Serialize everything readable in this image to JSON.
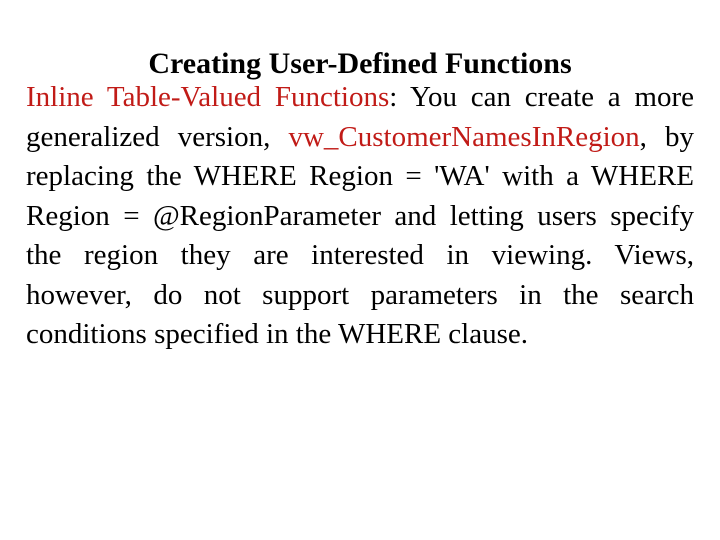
{
  "slide": {
    "title": "Creating User-Defined Functions",
    "body": {
      "term": "Inline Table-Valued Functions",
      "segment_after_term": ": You can create a more generalized version, ",
      "object_name": "vw_CustomerNamesInRegion",
      "segment_tail": ", by replacing the WHERE Region = 'WA' with a WHERE Region = @RegionParameter and letting users specify the region they are interested in viewing. Views, however, do not support parameters in the search conditions specified in the WHERE clause."
    },
    "colors": {
      "accent": "#c11b17",
      "text": "#000000",
      "background": "#ffffff"
    }
  }
}
